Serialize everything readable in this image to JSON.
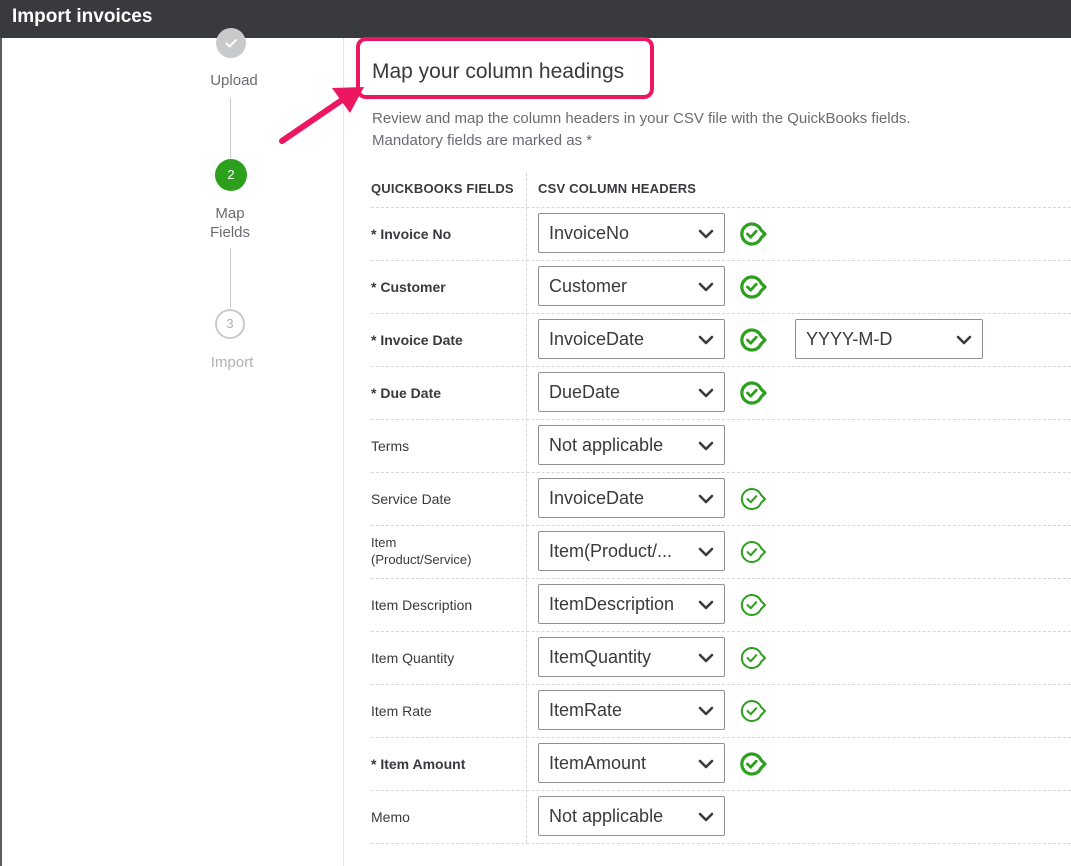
{
  "window": {
    "title": "Import invoices"
  },
  "stepper": {
    "steps": [
      {
        "number": "",
        "label": "Upload",
        "state": "done"
      },
      {
        "number": "2",
        "label_line1": "Map",
        "label_line2": "Fields",
        "state": "current"
      },
      {
        "number": "3",
        "label": "Import",
        "state": "pending"
      }
    ]
  },
  "main": {
    "heading": "Map your column headings",
    "description_line1": "Review and map the column headers in your CSV file with the QuickBooks fields.",
    "description_line2": "Mandatory fields are marked as *",
    "columns": {
      "left": "QUICKBOOKS FIELDS",
      "right": "CSV COLUMN HEADERS"
    },
    "rows": [
      {
        "label": "* Invoice No",
        "mandatory": true,
        "value": "InvoiceNo",
        "checked": true,
        "check_style": "bold"
      },
      {
        "label": "* Customer",
        "mandatory": true,
        "value": "Customer",
        "checked": true,
        "check_style": "bold"
      },
      {
        "label": "* Invoice Date",
        "mandatory": true,
        "value": "InvoiceDate",
        "checked": true,
        "check_style": "bold",
        "date_format": "YYYY-M-D"
      },
      {
        "label": "* Due Date",
        "mandatory": true,
        "value": "DueDate",
        "checked": true,
        "check_style": "bold"
      },
      {
        "label": "Terms",
        "mandatory": false,
        "value": "Not applicable",
        "checked": false
      },
      {
        "label": "Service Date",
        "mandatory": false,
        "value": "InvoiceDate",
        "checked": true,
        "check_style": "thin"
      },
      {
        "label_line1": "Item",
        "label_line2": "(Product/Service)",
        "mandatory": false,
        "value": "Item(Product/...",
        "checked": true,
        "check_style": "thin"
      },
      {
        "label": "Item Description",
        "mandatory": false,
        "value": "ItemDescription",
        "checked": true,
        "check_style": "thin"
      },
      {
        "label": "Item Quantity",
        "mandatory": false,
        "value": "ItemQuantity",
        "checked": true,
        "check_style": "thin"
      },
      {
        "label": "Item Rate",
        "mandatory": false,
        "value": "ItemRate",
        "checked": true,
        "check_style": "thin"
      },
      {
        "label": "* Item Amount",
        "mandatory": true,
        "value": "ItemAmount",
        "checked": true,
        "check_style": "bold"
      },
      {
        "label": "Memo",
        "mandatory": false,
        "value": "Not applicable",
        "checked": false
      }
    ]
  },
  "colors": {
    "green": "#2ca01c",
    "highlight": "#ec1661",
    "titlebar": "#393a3d"
  }
}
